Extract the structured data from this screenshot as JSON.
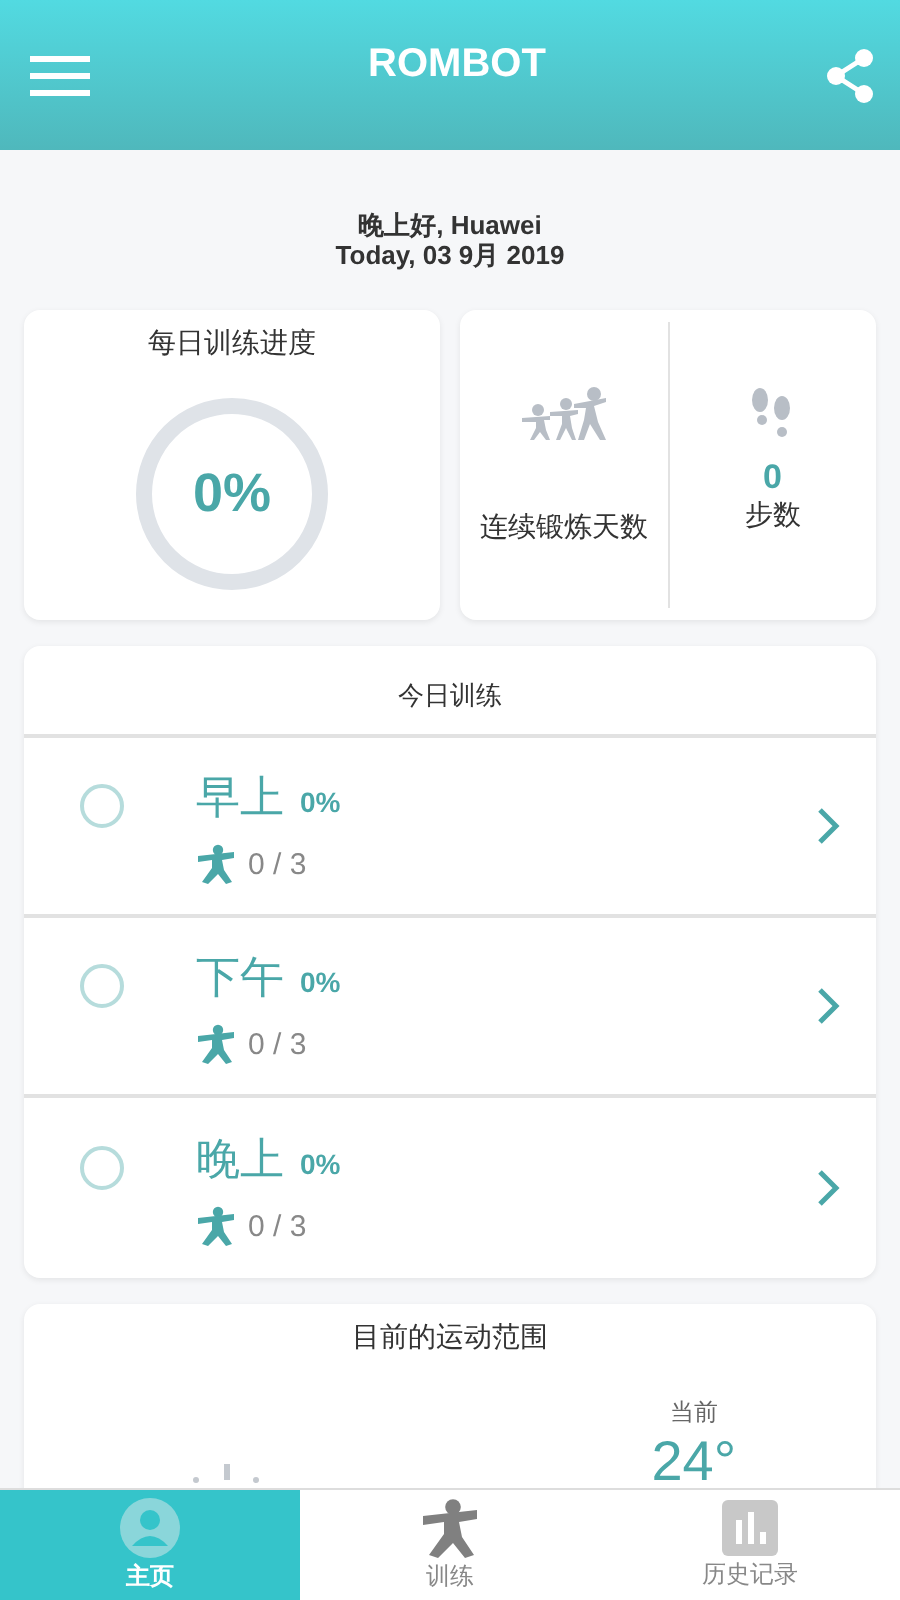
{
  "app_bar": {
    "title": "ROMBOT"
  },
  "greeting": {
    "line": "晚上好, Huawei",
    "date": "Today,  03 9月 2019"
  },
  "progress": {
    "title": "每日训练进度",
    "percent": "0%"
  },
  "streak": {
    "label": "连续锻炼天数"
  },
  "steps": {
    "value": "0",
    "label": "步数"
  },
  "training": {
    "title": "今日训练",
    "sessions": [
      {
        "name": "早上",
        "percent": "0%",
        "count": "0 / 3",
        "done": false
      },
      {
        "name": "下午",
        "percent": "0%",
        "count": "0 / 3",
        "done": false
      },
      {
        "name": "晚上",
        "percent": "0%",
        "count": "0 / 3",
        "done": false
      }
    ]
  },
  "range": {
    "title": "目前的运动范围",
    "current_label": "当前",
    "current_value": "24°"
  },
  "tabs": [
    {
      "label": "主页",
      "kind": "home",
      "selected": true
    },
    {
      "label": "训练",
      "kind": "training",
      "selected": false
    },
    {
      "label": "历史记录",
      "kind": "history",
      "selected": false
    }
  ]
}
